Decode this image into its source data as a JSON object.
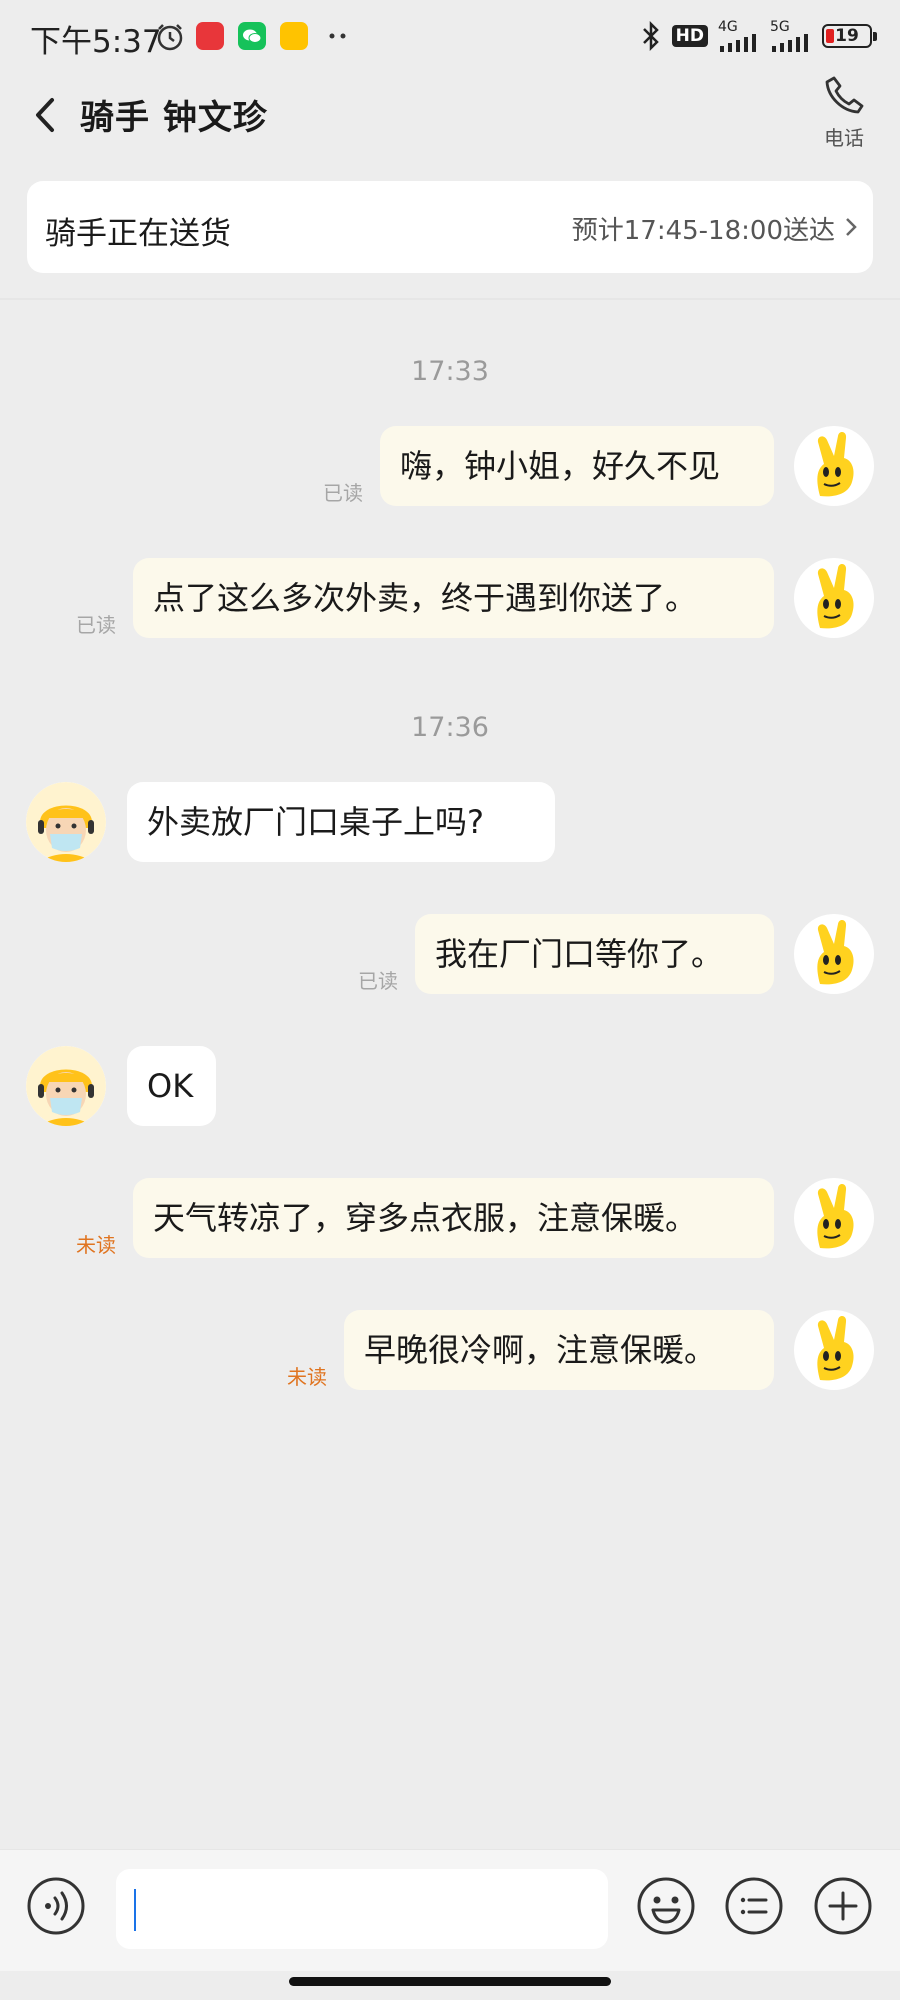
{
  "status_bar": {
    "time": "下午5:37",
    "network_1": "4G",
    "network_2": "5G",
    "hd_badge": "HD",
    "battery": "19",
    "colors": {
      "battery_low": "#e02020"
    },
    "icons": [
      "alarm-icon",
      "app-icon-red",
      "wechat-icon",
      "meituan-icon",
      "more-dots-icon",
      "bluetooth-icon",
      "signal-icon"
    ]
  },
  "header": {
    "title": "骑手 钟文珍",
    "phone_label": "电话"
  },
  "delivery": {
    "status": "骑手正在送货",
    "eta": "预计17:45-18:00送达"
  },
  "chat": {
    "timestamps": [
      "17:33",
      "17:36"
    ],
    "messages": [
      {
        "from": "me",
        "text": "嗨，钟小姐，好久不见",
        "read_status": "已读"
      },
      {
        "from": "me",
        "text": "点了这么多次外卖，终于遇到你送了。",
        "read_status": "已读"
      },
      {
        "from": "rider",
        "text": "外卖放厂门口桌子上吗?"
      },
      {
        "from": "me",
        "text": "我在厂门口等你了。",
        "read_status": "已读"
      },
      {
        "from": "rider",
        "text": "OK"
      },
      {
        "from": "me",
        "text": "天气转凉了，穿多点衣服，注意保暖。",
        "read_status": "未读"
      },
      {
        "from": "me",
        "text": "早晚很冷啊，注意保暖。",
        "read_status": "未读"
      }
    ],
    "colors": {
      "my_bubble": "#fcf9eb",
      "rider_bubble": "#ffffff",
      "unread": "#e07420",
      "read": "#a6a6a6"
    }
  },
  "input_bar": {
    "value": "",
    "icons": [
      "voice-icon",
      "emoji-icon",
      "quick-reply-icon",
      "add-icon"
    ]
  }
}
